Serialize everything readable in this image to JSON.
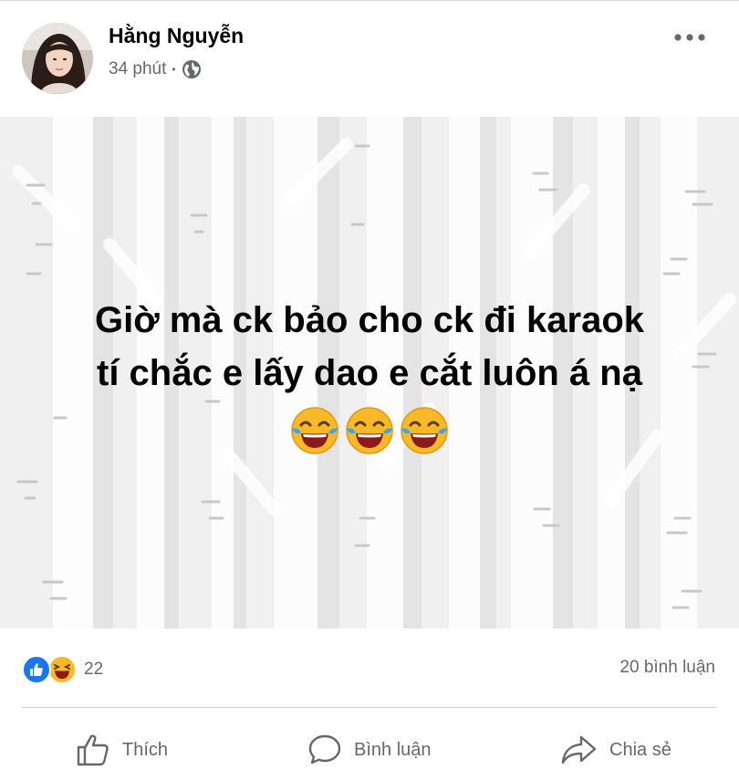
{
  "post": {
    "author_name": "Hằng Nguyễn",
    "time_ago": "34 phút",
    "meta_separator": "•",
    "privacy_icon": "globe-icon",
    "options_icon": "more-horizontal-icon",
    "text_lines": [
      "Giờ mà ck bảo cho ck đi karaok",
      "tí chắc e lấy dao e cắt luôn á nạ"
    ],
    "emojis": [
      "😂",
      "😂",
      "😂"
    ],
    "background_color": "#f0f0f0"
  },
  "stats": {
    "reaction_icons": [
      "like-reaction-icon",
      "haha-reaction-icon"
    ],
    "reaction_count": "22",
    "comment_count": "20 bình luận"
  },
  "actions": {
    "like_label": "Thích",
    "comment_label": "Bình luận",
    "share_label": "Chia sẻ"
  },
  "colors": {
    "like_blue": "#1877f2",
    "haha_yellow": "#f7b928",
    "secondary_text": "#65676b"
  }
}
